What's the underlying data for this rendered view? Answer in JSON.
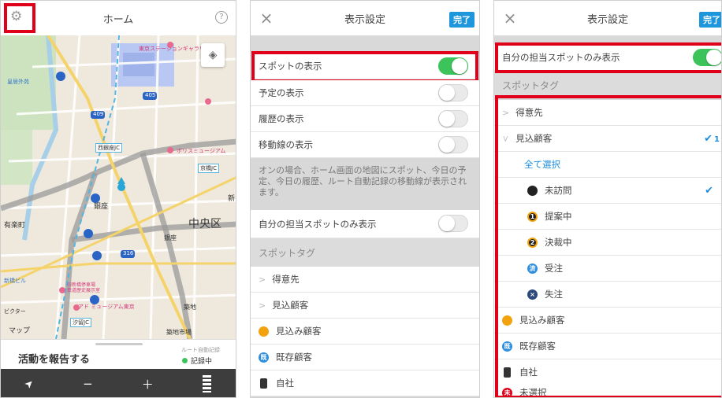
{
  "home": {
    "title": "ホーム",
    "map_labels": {
      "station": "東京ステーションギャラリー",
      "nishiginza": "西銀座JC",
      "kyobashi": "京橋JC",
      "ginza": "銀座",
      "chuo": "中央区",
      "ginza2": "銀座",
      "yurakucho": "有楽町",
      "tsukiji": "築地",
      "shiodome": "汐留JC",
      "tsukiji_market": "築地市場",
      "police": "ポリスミュージアム",
      "kokkai": "皇居外苑",
      "sin": "新",
      "building": "新橋ビル",
      "market2": "旧新橋停車場\n鉄道歴史展示室",
      "museum": "アド ミュージアム東京",
      "plaza": "ビクター",
      "maps": "マップ",
      "route_405": "405",
      "route_409": "409",
      "route_316": "316"
    },
    "report": "活動を報告する",
    "route_record": "ルート自動記録",
    "recording": "記録中",
    "toolbar": {
      "locate": "➤",
      "minus": "−",
      "plus": "＋"
    }
  },
  "display": {
    "title": "表示設定",
    "done": "完了",
    "rows": [
      {
        "label": "スポットの表示",
        "on": true
      },
      {
        "label": "予定の表示",
        "on": false
      },
      {
        "label": "履歴の表示",
        "on": false
      },
      {
        "label": "移動線の表示",
        "on": false
      }
    ],
    "note": "オンの場合、ホーム画面の地図にスポット、今日の予定、今日の履歴、ルート自動記録の移動線が表示されます。",
    "own_only": "自分の担当スポットのみ表示",
    "spot_tag": "スポットタグ",
    "tags": [
      "得意先",
      "見込顧客"
    ],
    "items": [
      "見込み顧客",
      "既存顧客",
      "自社"
    ]
  },
  "display2": {
    "title": "表示設定",
    "done": "完了",
    "own_only": "自分の担当スポットのみ表示",
    "spot_tag": "スポットタグ",
    "tag1": "得意先",
    "tag2": "見込顧客",
    "tag2_count": "1",
    "select_all": "全て選択",
    "subs": [
      {
        "label": "未訪問",
        "checked": true,
        "color": "#222222",
        "num": ""
      },
      {
        "label": "提案中",
        "checked": false,
        "color": "#f2a20d",
        "num": "1"
      },
      {
        "label": "決裁中",
        "checked": false,
        "color": "#f2a20d",
        "num": "2"
      },
      {
        "label": "受注",
        "checked": false,
        "color": "#2d8ee0",
        "num": "済"
      },
      {
        "label": "失注",
        "checked": false,
        "color": "#2c4a7a",
        "num": "×"
      }
    ],
    "items": [
      {
        "label": "見込み顧客",
        "color": "#f2a20d"
      },
      {
        "label": "既存顧客",
        "color": "#2d8ee0"
      },
      {
        "label": "自社",
        "color": "#333333"
      },
      {
        "label": "未選択",
        "color": "#e1001a"
      }
    ]
  }
}
